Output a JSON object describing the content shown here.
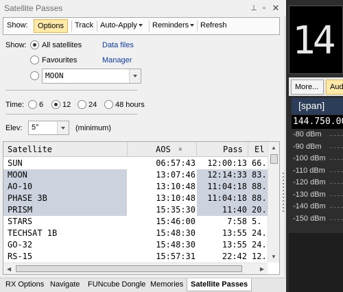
{
  "window": {
    "title": "Satellite Passes"
  },
  "toolbar": {
    "show_label": "Show:",
    "options": "Options",
    "track": "Track",
    "auto_apply": "Auto-Apply",
    "reminders": "Reminders",
    "refresh": "Refresh"
  },
  "filters": {
    "show_label": "Show:",
    "all_satellites": "All satellites",
    "favourites": "Favourites",
    "selected_sat": "MOON",
    "data_files_link_1": "Data files",
    "data_files_link_2": "Manager",
    "time_label": "Time:",
    "time_options": [
      "6",
      "12",
      "24",
      "48 hours"
    ],
    "time_selected": "12",
    "elev_label": "Elev:",
    "elev_value": "5°",
    "elev_suffix": "(minimum)"
  },
  "table": {
    "headers": {
      "satellite": "Satellite",
      "aos": "AOS",
      "pass": "Pass",
      "el": "El"
    },
    "rows": [
      {
        "sat": "SUN",
        "aos": "06:57:43",
        "pass": "12:00:13",
        "el": "66.",
        "hl": false
      },
      {
        "sat": "MOON",
        "aos": "13:07:46",
        "pass": "12:14:33",
        "el": "83.",
        "hl": true
      },
      {
        "sat": "AO-10",
        "aos": "13:10:48",
        "pass": "11:04:18",
        "el": "88.",
        "hl": true
      },
      {
        "sat": "PHASE 3B",
        "aos": "13:10:48",
        "pass": "11:04:18",
        "el": "88.",
        "hl": true
      },
      {
        "sat": "PRISM",
        "aos": "15:35:30",
        "pass": "11:40",
        "el": "20.",
        "hl": true
      },
      {
        "sat": "STARS",
        "aos": "15:46:00",
        "pass": "7:58",
        "el": "5.",
        "hl": false
      },
      {
        "sat": "TECHSAT 1B",
        "aos": "15:48:30",
        "pass": "13:55",
        "el": "24.",
        "hl": false
      },
      {
        "sat": "GO-32",
        "aos": "15:48:30",
        "pass": "13:55",
        "el": "24.",
        "hl": false
      },
      {
        "sat": "RS-15",
        "aos": "15:57:31",
        "pass": "22:42",
        "el": "12.",
        "hl": false
      }
    ]
  },
  "tabs": [
    "RX Options",
    "Navigate",
    "FUNcube Dongle",
    "Memories",
    "Satellite Passes"
  ],
  "active_tab": "Satellite Passes",
  "right": {
    "lcd_digits": "14",
    "more_button": "More...",
    "audio_button": "Aud",
    "span_label": "[span]",
    "frequency": "144.750.00",
    "db_scale": [
      "-80 dBm",
      "-90 dBm",
      "-100 dBm",
      "-110 dBm",
      "-120 dBm",
      "-130 dBm",
      "-140 dBm",
      "-150 dBm"
    ]
  },
  "colors": {
    "row_highlight": "#cdd3de",
    "accent_button": "#fde9a8",
    "link": "#0a3aa8",
    "span_bg": "#2b3d59"
  }
}
